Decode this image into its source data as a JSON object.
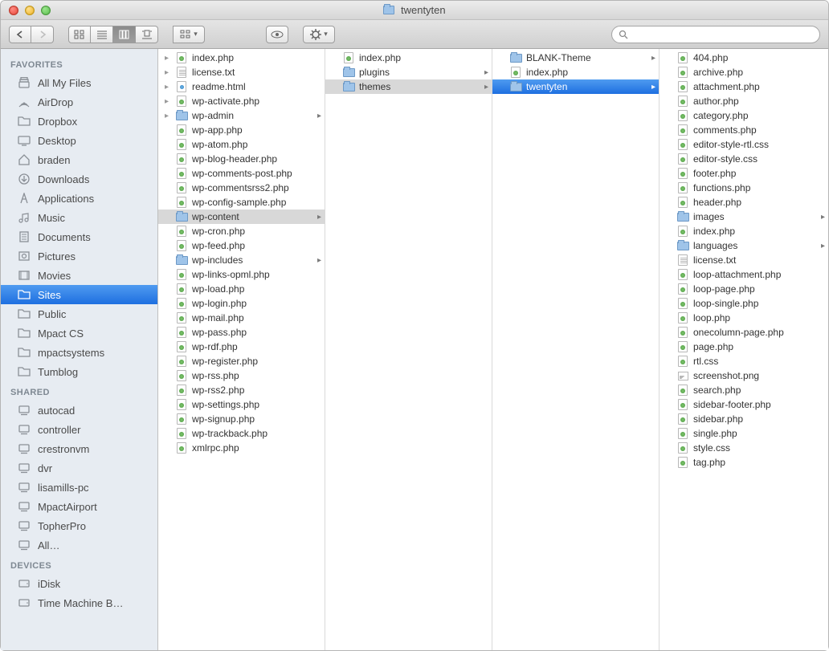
{
  "window": {
    "title": "twentyten"
  },
  "search": {
    "placeholder": ""
  },
  "sidebar": {
    "sections": [
      {
        "label": "FAVORITES",
        "items": [
          {
            "icon": "allmyfiles",
            "label": "All My Files"
          },
          {
            "icon": "airdrop",
            "label": "AirDrop"
          },
          {
            "icon": "folder",
            "label": "Dropbox"
          },
          {
            "icon": "desktop",
            "label": "Desktop"
          },
          {
            "icon": "home",
            "label": "braden"
          },
          {
            "icon": "downloads",
            "label": "Downloads"
          },
          {
            "icon": "applications",
            "label": "Applications"
          },
          {
            "icon": "music",
            "label": "Music"
          },
          {
            "icon": "documents",
            "label": "Documents"
          },
          {
            "icon": "pictures",
            "label": "Pictures"
          },
          {
            "icon": "movies",
            "label": "Movies"
          },
          {
            "icon": "folder",
            "label": "Sites",
            "selected": true
          },
          {
            "icon": "folder",
            "label": "Public"
          },
          {
            "icon": "folder",
            "label": "Mpact CS"
          },
          {
            "icon": "folder",
            "label": "mpactsystems"
          },
          {
            "icon": "folder",
            "label": "Tumblog"
          }
        ]
      },
      {
        "label": "SHARED",
        "items": [
          {
            "icon": "computer",
            "label": "autocad"
          },
          {
            "icon": "computer",
            "label": "controller"
          },
          {
            "icon": "computer",
            "label": "crestronvm"
          },
          {
            "icon": "computer",
            "label": "dvr"
          },
          {
            "icon": "computer",
            "label": "lisamills-pc"
          },
          {
            "icon": "computer",
            "label": "MpactAirport"
          },
          {
            "icon": "computer",
            "label": "TopherPro"
          },
          {
            "icon": "computer",
            "label": "All…"
          }
        ]
      },
      {
        "label": "DEVICES",
        "items": [
          {
            "icon": "disk",
            "label": "iDisk"
          },
          {
            "icon": "disk",
            "label": "Time Machine B…"
          }
        ]
      }
    ]
  },
  "columns": [
    {
      "items": [
        {
          "type": "php",
          "name": "index.php",
          "disc": true
        },
        {
          "type": "txt",
          "name": "license.txt",
          "disc": true
        },
        {
          "type": "html",
          "name": "readme.html",
          "disc": true
        },
        {
          "type": "php",
          "name": "wp-activate.php",
          "disc": true
        },
        {
          "type": "folder",
          "name": "wp-admin",
          "disc": true
        },
        {
          "type": "php",
          "name": "wp-app.php"
        },
        {
          "type": "php",
          "name": "wp-atom.php"
        },
        {
          "type": "php",
          "name": "wp-blog-header.php"
        },
        {
          "type": "php",
          "name": "wp-comments-post.php"
        },
        {
          "type": "php",
          "name": "wp-commentsrss2.php"
        },
        {
          "type": "php",
          "name": "wp-config-sample.php"
        },
        {
          "type": "folder",
          "name": "wp-content",
          "selected": true
        },
        {
          "type": "php",
          "name": "wp-cron.php"
        },
        {
          "type": "php",
          "name": "wp-feed.php"
        },
        {
          "type": "folder",
          "name": "wp-includes"
        },
        {
          "type": "php",
          "name": "wp-links-opml.php"
        },
        {
          "type": "php",
          "name": "wp-load.php"
        },
        {
          "type": "php",
          "name": "wp-login.php"
        },
        {
          "type": "php",
          "name": "wp-mail.php"
        },
        {
          "type": "php",
          "name": "wp-pass.php"
        },
        {
          "type": "php",
          "name": "wp-rdf.php"
        },
        {
          "type": "php",
          "name": "wp-register.php"
        },
        {
          "type": "php",
          "name": "wp-rss.php"
        },
        {
          "type": "php",
          "name": "wp-rss2.php"
        },
        {
          "type": "php",
          "name": "wp-settings.php"
        },
        {
          "type": "php",
          "name": "wp-signup.php"
        },
        {
          "type": "php",
          "name": "wp-trackback.php"
        },
        {
          "type": "php",
          "name": "xmlrpc.php"
        }
      ]
    },
    {
      "items": [
        {
          "type": "php",
          "name": "index.php"
        },
        {
          "type": "folder",
          "name": "plugins"
        },
        {
          "type": "folder",
          "name": "themes",
          "selected": true
        }
      ]
    },
    {
      "items": [
        {
          "type": "folder",
          "name": "BLANK-Theme"
        },
        {
          "type": "php",
          "name": "index.php"
        },
        {
          "type": "folder",
          "name": "twentyten",
          "selected": true,
          "active": true
        }
      ]
    },
    {
      "items": [
        {
          "type": "php",
          "name": "404.php"
        },
        {
          "type": "php",
          "name": "archive.php"
        },
        {
          "type": "php",
          "name": "attachment.php"
        },
        {
          "type": "php",
          "name": "author.php"
        },
        {
          "type": "php",
          "name": "category.php"
        },
        {
          "type": "php",
          "name": "comments.php"
        },
        {
          "type": "css",
          "name": "editor-style-rtl.css"
        },
        {
          "type": "css",
          "name": "editor-style.css"
        },
        {
          "type": "php",
          "name": "footer.php"
        },
        {
          "type": "php",
          "name": "functions.php"
        },
        {
          "type": "php",
          "name": "header.php"
        },
        {
          "type": "folder",
          "name": "images"
        },
        {
          "type": "php",
          "name": "index.php"
        },
        {
          "type": "folder",
          "name": "languages"
        },
        {
          "type": "txt",
          "name": "license.txt"
        },
        {
          "type": "php",
          "name": "loop-attachment.php"
        },
        {
          "type": "php",
          "name": "loop-page.php"
        },
        {
          "type": "php",
          "name": "loop-single.php"
        },
        {
          "type": "php",
          "name": "loop.php"
        },
        {
          "type": "php",
          "name": "onecolumn-page.php"
        },
        {
          "type": "php",
          "name": "page.php"
        },
        {
          "type": "css",
          "name": "rtl.css"
        },
        {
          "type": "png",
          "name": "screenshot.png"
        },
        {
          "type": "php",
          "name": "search.php"
        },
        {
          "type": "php",
          "name": "sidebar-footer.php"
        },
        {
          "type": "php",
          "name": "sidebar.php"
        },
        {
          "type": "php",
          "name": "single.php"
        },
        {
          "type": "css",
          "name": "style.css"
        },
        {
          "type": "php",
          "name": "tag.php"
        }
      ]
    }
  ]
}
